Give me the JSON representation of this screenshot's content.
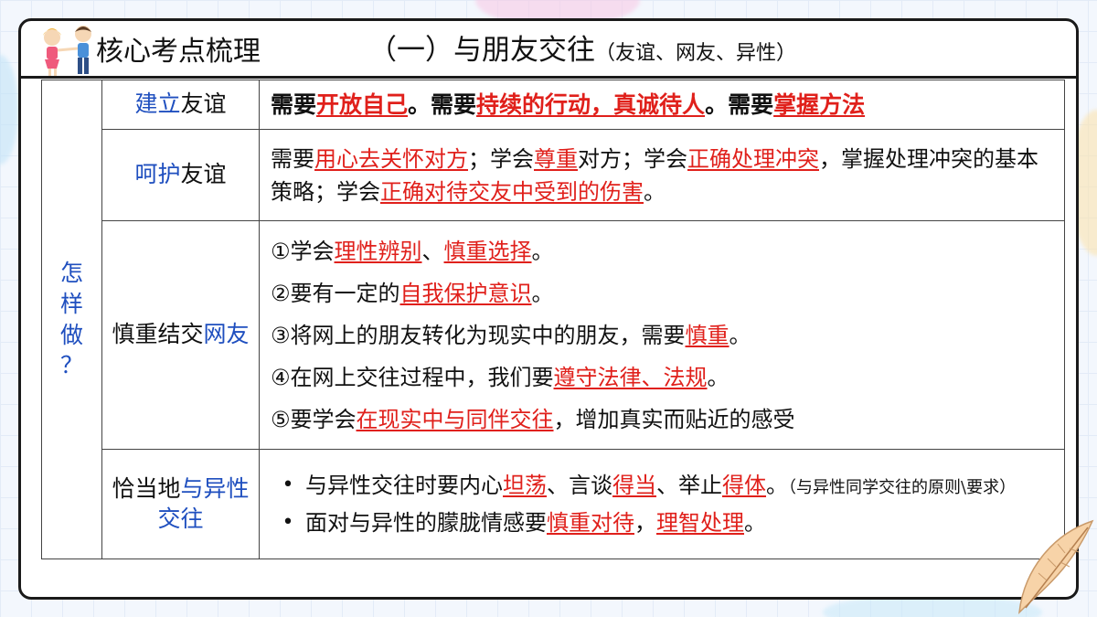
{
  "header": {
    "label": "核心考点梳理",
    "title_main": "（一）与朋友交往",
    "title_sub": "（友谊、网友、异性）"
  },
  "side_label": [
    "怎",
    "样",
    "做",
    "？"
  ],
  "rows": [
    {
      "category": [
        {
          "t": "建立",
          "c": "blue"
        },
        {
          "t": "友谊",
          "c": "black"
        }
      ],
      "desc": [
        {
          "t": "需要",
          "s": "b"
        },
        {
          "t": "开放自己",
          "s": "bu"
        },
        {
          "t": "。需要",
          "s": "b"
        },
        {
          "t": "持续的行动，真诚待人",
          "s": "bu"
        },
        {
          "t": "。需要",
          "s": "b"
        },
        {
          "t": "掌握方法",
          "s": "bu"
        }
      ]
    },
    {
      "category": [
        {
          "t": "呵护",
          "c": "blue"
        },
        {
          "t": "友谊",
          "c": "black"
        }
      ],
      "desc": [
        {
          "t": "需要",
          "s": "n"
        },
        {
          "t": "用心去关怀对方",
          "s": "u"
        },
        {
          "t": "；学会",
          "s": "n"
        },
        {
          "t": "尊重",
          "s": "u"
        },
        {
          "t": "对方；学会",
          "s": "n"
        },
        {
          "t": "正确处理冲突",
          "s": "u"
        },
        {
          "t": "，掌握处理冲突的基本策略；学会",
          "s": "n"
        },
        {
          "t": "正确对待交友中受到的伤害",
          "s": "u"
        },
        {
          "t": "。",
          "s": "n"
        }
      ]
    },
    {
      "category": [
        {
          "t": "慎重结交",
          "c": "black"
        },
        {
          "t": "网友",
          "c": "blue"
        }
      ],
      "items": [
        [
          {
            "t": "①学会",
            "s": "n"
          },
          {
            "t": "理性辨别",
            "s": "u"
          },
          {
            "t": "、",
            "s": "n"
          },
          {
            "t": "慎重选择",
            "s": "u"
          },
          {
            "t": "。",
            "s": "n"
          }
        ],
        [
          {
            "t": "②要有一定的",
            "s": "n"
          },
          {
            "t": "自我保护意识",
            "s": "u"
          },
          {
            "t": "。",
            "s": "n"
          }
        ],
        [
          {
            "t": "③将网上的朋友转化为现实中的朋友，需要",
            "s": "n"
          },
          {
            "t": "慎重",
            "s": "u"
          },
          {
            "t": "。",
            "s": "n"
          }
        ],
        [
          {
            "t": "④在网上交往过程中，我们要",
            "s": "n"
          },
          {
            "t": "遵守法律、法规",
            "s": "u"
          },
          {
            "t": "。",
            "s": "n"
          }
        ],
        [
          {
            "t": "⑤要学会",
            "s": "n"
          },
          {
            "t": "在现实中与同伴交往",
            "s": "u"
          },
          {
            "t": "，增加真实而贴近的感受",
            "s": "n"
          }
        ]
      ]
    },
    {
      "category": [
        {
          "t": "恰当地",
          "c": "black"
        },
        {
          "t": "与异性",
          "c": "blue"
        },
        {
          "t": "交往",
          "c": "blue"
        }
      ],
      "bullets": [
        [
          {
            "t": "与异性交往时要内心",
            "s": "n"
          },
          {
            "t": "坦荡",
            "s": "u"
          },
          {
            "t": "、言谈",
            "s": "n"
          },
          {
            "t": "得当",
            "s": "u"
          },
          {
            "t": "、举止",
            "s": "n"
          },
          {
            "t": "得体",
            "s": "u"
          },
          {
            "t": "。",
            "s": "n"
          },
          {
            "t": "（与异性同学交往的原则\\要求）",
            "s": "small"
          }
        ],
        [
          {
            "t": "面对与异性的朦胧情感要",
            "s": "n"
          },
          {
            "t": "慎重对待",
            "s": "u"
          },
          {
            "t": "，",
            "s": "n"
          },
          {
            "t": "理智处理",
            "s": "u"
          },
          {
            "t": "。",
            "s": "n"
          }
        ]
      ],
      "bullet_symbol": "•"
    }
  ],
  "colors": {
    "accent_blue": "#1f4fbf",
    "highlight_red": "#e0201b",
    "border": "#1a1a1a"
  },
  "icons": [
    "kids-illustration",
    "feather-decoration"
  ]
}
